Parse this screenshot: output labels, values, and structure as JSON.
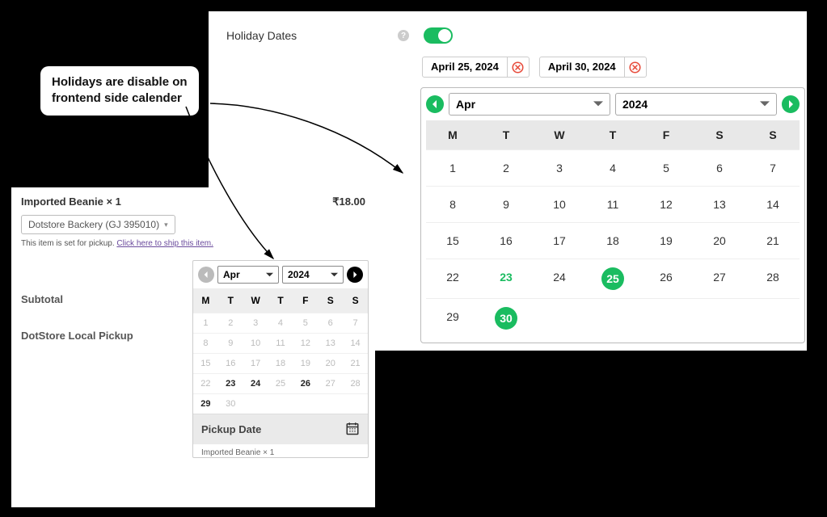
{
  "callout": {
    "line1": "Holidays are disable on",
    "line2": "frontend side calender"
  },
  "admin": {
    "label": "Holiday Dates",
    "help": "?",
    "chips": [
      {
        "label": "April 25, 2024"
      },
      {
        "label": "April 30, 2024"
      }
    ],
    "month": "Apr",
    "year": "2024",
    "dow": [
      "M",
      "T",
      "W",
      "T",
      "F",
      "S",
      "S"
    ],
    "weeks": [
      [
        1,
        2,
        3,
        4,
        5,
        6,
        7
      ],
      [
        8,
        9,
        10,
        11,
        12,
        13,
        14
      ],
      [
        15,
        16,
        17,
        18,
        19,
        20,
        21
      ],
      [
        22,
        23,
        24,
        25,
        26,
        27,
        28
      ],
      [
        29,
        30,
        null,
        null,
        null,
        null,
        null
      ]
    ],
    "today": 23,
    "holidays": [
      25,
      30
    ]
  },
  "checkout": {
    "item_name": "Imported Beanie  × 1",
    "item_price": "₹18.00",
    "store": "Dotstore Backery (GJ 395010)",
    "note_prefix": "This item is set for pickup. ",
    "note_link": "Click here to ship this item.",
    "subtotal_label": "Subtotal",
    "pickup_label": "DotStore Local Pickup",
    "pickup_date_label": "Pickup Date",
    "footer": "Imported Beanie × 1",
    "cal": {
      "month": "Apr",
      "year": "2024",
      "dow": [
        "M",
        "T",
        "W",
        "T",
        "F",
        "S",
        "S"
      ],
      "weeks": [
        [
          1,
          2,
          3,
          4,
          5,
          6,
          7
        ],
        [
          8,
          9,
          10,
          11,
          12,
          13,
          14
        ],
        [
          15,
          16,
          17,
          18,
          19,
          20,
          21
        ],
        [
          22,
          23,
          24,
          25,
          26,
          27,
          28
        ],
        [
          29,
          30,
          null,
          null,
          null,
          null,
          null
        ]
      ],
      "available": [
        23,
        24,
        26,
        29
      ]
    }
  }
}
